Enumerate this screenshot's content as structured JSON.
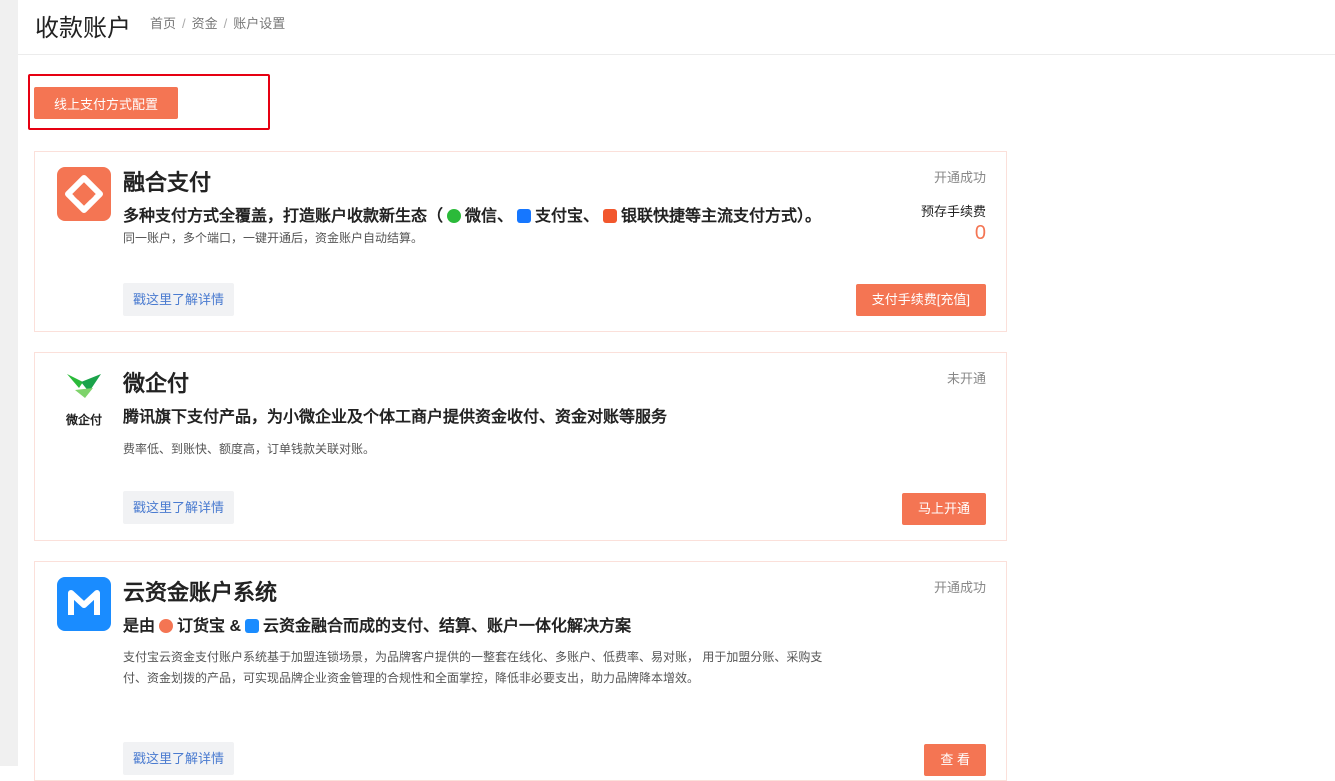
{
  "header": {
    "title": "收款账户",
    "breadcrumb": [
      "首页",
      "资金",
      "账户设置"
    ]
  },
  "config_button": "线上支付方式配置",
  "cards": [
    {
      "title": "融合支付",
      "status": "开通成功",
      "subtitle": {
        "prefix": "多种支付方式全覆盖，打造账户收款新生态（",
        "wechat": "微信、",
        "alipay": "支付宝、",
        "unionpay": "银联快捷等主流支付方式）。"
      },
      "desc": "同一账户，多个端口，一键开通后，资金账户自动结算。",
      "fee_label": "预存手续费",
      "fee_value": "0",
      "link": "戳这里了解详情",
      "action": "支付手续费[充值]"
    },
    {
      "title": "微企付",
      "status": "未开通",
      "logo_text": "微企付",
      "subtitle": "腾讯旗下支付产品，为小微企业及个体工商户提供资金收付、资金对账等服务",
      "desc": "费率低、到账快、额度高，订单钱款关联对账。",
      "link": "戳这里了解详情",
      "action": "马上开通"
    },
    {
      "title": "云资金账户系统",
      "status": "开通成功",
      "subtitle": {
        "prefix": "是由",
        "dhb": "订货宝 &",
        "suffix": "云资金融合而成的支付、结算、账户一体化解决方案"
      },
      "desc": "支付宝云资金支付账户系统基于加盟连锁场景，为品牌客户提供的一整套在线化、多账户、低费率、易对账， 用于加盟分账、采购支付、资金划拨的产品，可实现品牌企业资金管理的合规性和全面掌控，降低非必要支出，助力品牌降本增效。",
      "link": "戳这里了解详情",
      "action": "查 看"
    }
  ],
  "colors": {
    "accent": "#f47553",
    "highlight": "#e60012",
    "link": "#4a7bd0"
  }
}
